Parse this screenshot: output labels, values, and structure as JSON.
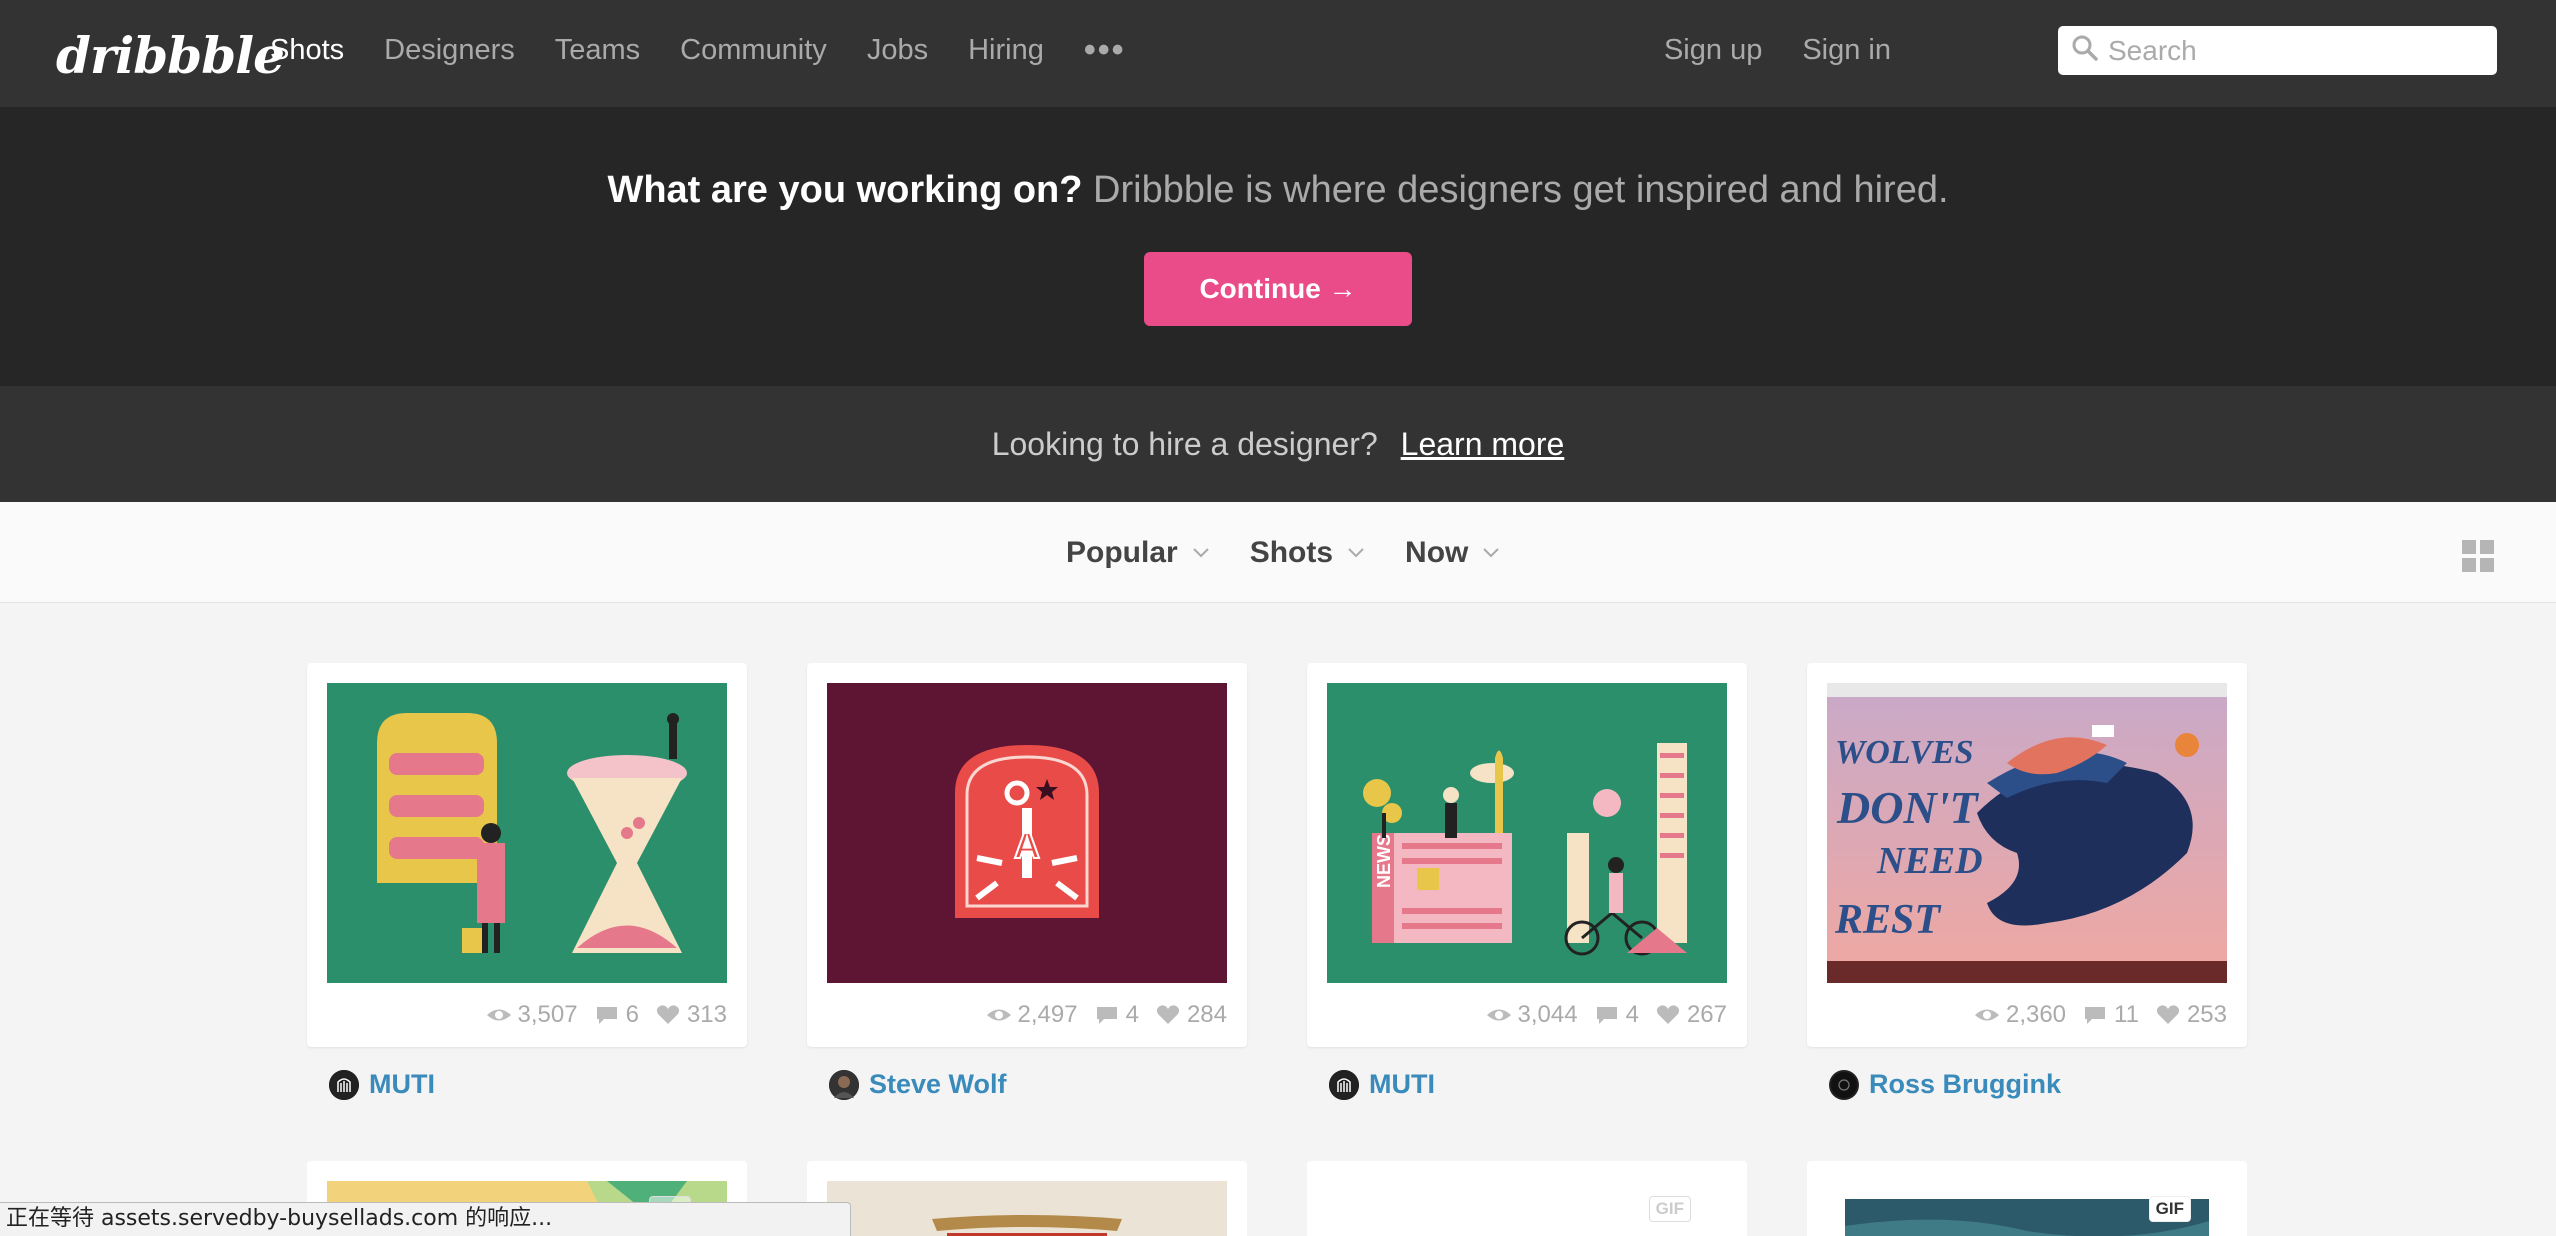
{
  "nav": {
    "logo": "dribbble",
    "links": [
      "Shots",
      "Designers",
      "Teams",
      "Community",
      "Jobs",
      "Hiring"
    ],
    "more": "•••",
    "signup": "Sign up",
    "signin": "Sign in",
    "search_placeholder": "Search"
  },
  "hero": {
    "question": "What are you working on?",
    "tagline": "Dribbble is where designers get inspired and hired.",
    "cta": "Continue →"
  },
  "hire": {
    "text": "Looking to hire a designer?",
    "link": "Learn more"
  },
  "filters": {
    "sort": "Popular",
    "type": "Shots",
    "time": "Now"
  },
  "shots": [
    {
      "views": "3,507",
      "comments": "6",
      "likes": "313",
      "author": "MUTI"
    },
    {
      "views": "2,497",
      "comments": "4",
      "likes": "284",
      "author": "Steve Wolf"
    },
    {
      "views": "3,044",
      "comments": "4",
      "likes": "267",
      "author": "MUTI"
    },
    {
      "views": "2,360",
      "comments": "11",
      "likes": "253",
      "author": "Ross Bruggink"
    }
  ],
  "thumb_text": {
    "wolves": "WOLVES",
    "dont": "DON'T",
    "need": "NEED",
    "rest": "REST",
    "news": "NEWS"
  },
  "gif_badge": "GIF",
  "statusbar": "正在等待 assets.servedby-buysellads.com 的响应..."
}
